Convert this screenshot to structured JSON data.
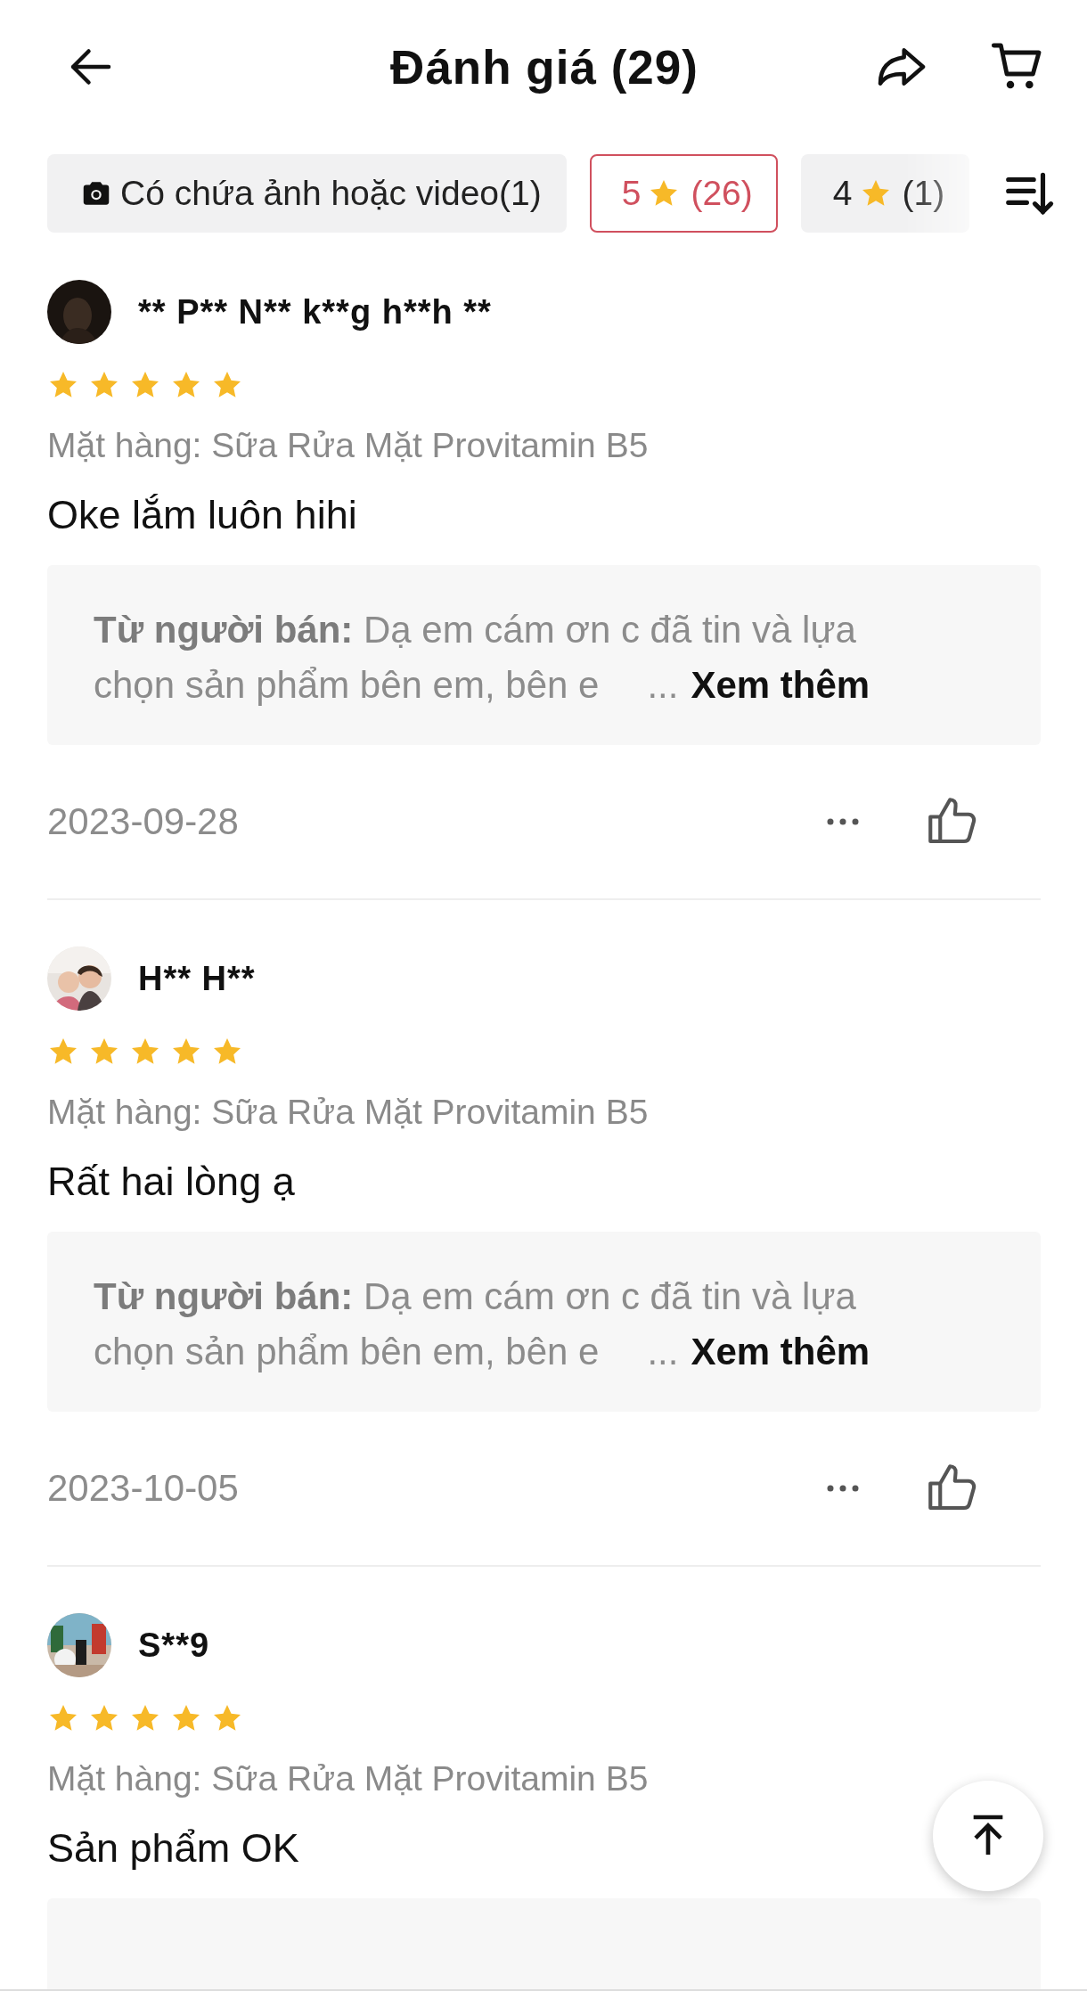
{
  "header": {
    "title": "Đánh giá (29)"
  },
  "filters": [
    {
      "kind": "media",
      "label": "Có chứa ảnh hoặc video(1)",
      "selected": false
    },
    {
      "kind": "stars",
      "label": "5",
      "count": "(26)",
      "selected": true
    },
    {
      "kind": "stars",
      "label": "4",
      "count": "(1)",
      "selected": false
    }
  ],
  "reviews": [
    {
      "name": "** P** N** k**g h**h **",
      "stars": 5,
      "item": "Mặt hàng: Sữa Rửa Mặt Provitamin B5",
      "comment": "Oke lắm luôn hihi",
      "reply": {
        "text": "**Từ người bán:** Dạ em cám ơn c đã tin và lựa chọn sản phẩm bên em, bên e",
        "ellipsis": "...",
        "more": "Xem thêm"
      },
      "date": "2023-09-28"
    },
    {
      "name": "H** H**",
      "stars": 5,
      "item": "Mặt hàng: Sữa Rửa Mặt Provitamin B5",
      "comment": "Rất hai lòng ạ",
      "reply": {
        "text": "**Từ người bán:** Dạ em cám ơn c đã tin và lựa chọn sản phẩm bên em, bên e",
        "ellipsis": "...",
        "more": "Xem thêm"
      },
      "date": "2023-10-05"
    },
    {
      "name": "S**9",
      "stars": 5,
      "item": "Mặt hàng: Sữa Rửa Mặt Provitamin B5",
      "comment": "Sản phẩm OK",
      "reply_cut": true
    }
  ]
}
